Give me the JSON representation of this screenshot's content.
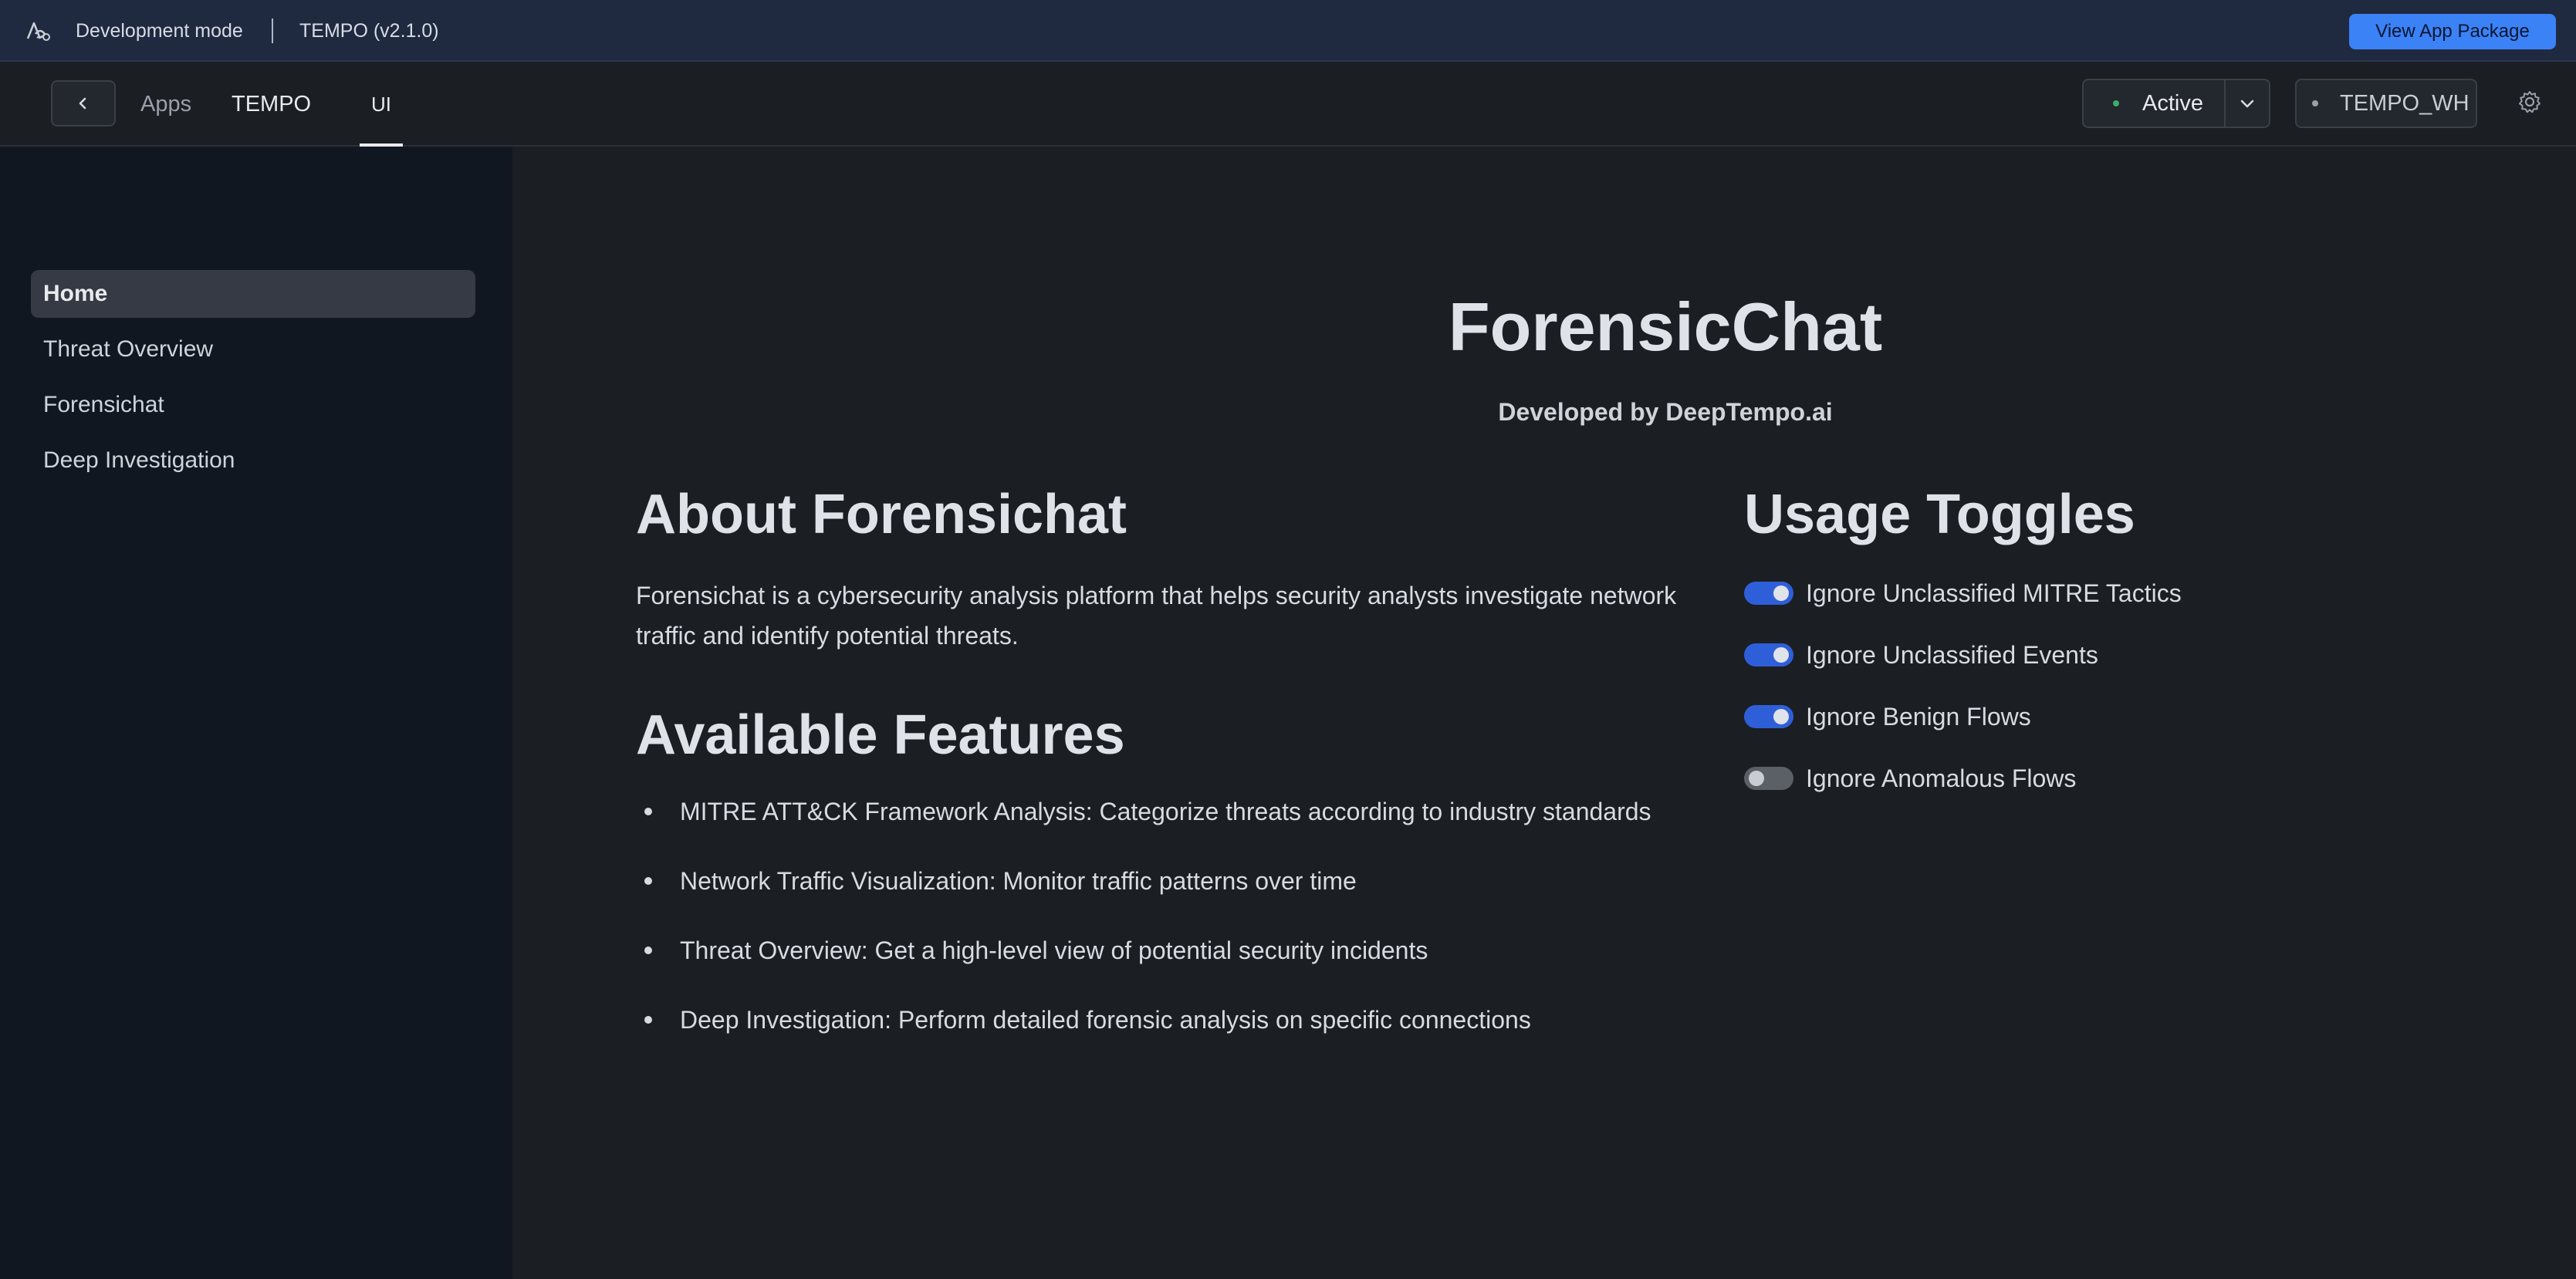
{
  "devbar": {
    "mode": "Development mode",
    "app_version": "TEMPO (v2.1.0)",
    "package_button": "View App Package"
  },
  "nav": {
    "apps": "Apps",
    "app": "TEMPO",
    "tab": "UI",
    "status": "Active",
    "warehouse": "TEMPO_WH"
  },
  "sidebar": {
    "items": [
      {
        "label": "Home",
        "active": true
      },
      {
        "label": "Threat Overview",
        "active": false
      },
      {
        "label": "Forensichat",
        "active": false
      },
      {
        "label": "Deep Investigation",
        "active": false
      }
    ]
  },
  "main": {
    "title": "ForensicChat",
    "subtitle": "Developed by DeepTempo.ai",
    "about_heading": "About Forensichat",
    "about_text": "Forensichat is a cybersecurity analysis platform that helps security analysts investigate network traffic and identify potential threats.",
    "features_heading": "Available Features",
    "features": [
      "MITRE ATT&CK Framework Analysis: Categorize threats according to industry standards",
      "Network Traffic Visualization: Monitor traffic patterns over time",
      "Threat Overview: Get a high-level view of potential security incidents",
      "Deep Investigation: Perform detailed forensic analysis on specific connections"
    ],
    "usage_heading": "Usage Toggles",
    "toggles": [
      {
        "label": "Ignore Unclassified MITRE Tactics",
        "on": true
      },
      {
        "label": "Ignore Unclassified Events",
        "on": true
      },
      {
        "label": "Ignore Benign Flows",
        "on": true
      },
      {
        "label": "Ignore Anomalous Flows",
        "on": false
      }
    ]
  },
  "colors": {
    "accent": "#3b82f6",
    "toggle_on": "#2f5fd8",
    "status_dot": "#3cae6b"
  }
}
